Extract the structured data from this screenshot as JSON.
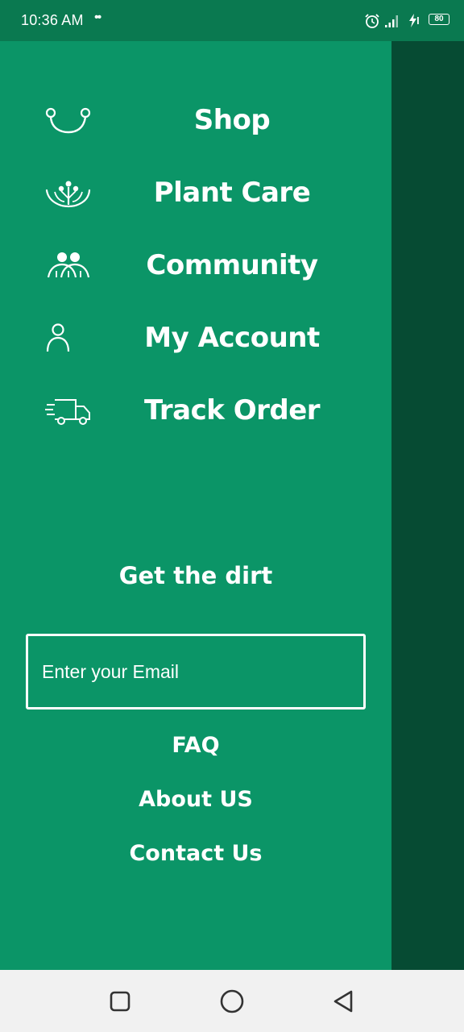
{
  "status_bar": {
    "time": "10:36 AM",
    "dots": "••",
    "battery": "80",
    "icons": [
      "alarm-icon",
      "signal-icon",
      "charging-icon",
      "battery-icon"
    ]
  },
  "drawer": {
    "menu": [
      {
        "label": "Shop",
        "icon": "shop-icon"
      },
      {
        "label": "Plant Care",
        "icon": "plant-care-icon"
      },
      {
        "label": "Community",
        "icon": "community-icon"
      },
      {
        "label": "My Account",
        "icon": "account-icon"
      },
      {
        "label": "Track Order",
        "icon": "truck-icon"
      }
    ],
    "newsletter_title": "Get the dirt",
    "email_placeholder": "Enter your Email",
    "links": {
      "faq": "FAQ",
      "about": "About US",
      "contact": "Contact Us"
    }
  },
  "colors": {
    "drawer_bg": "#0b9567",
    "status_bar_bg": "#0a7950",
    "overlay_bg": "#064b33",
    "text": "#ffffff",
    "nav_bar_bg": "#f1f1f1"
  },
  "nav_bar": {
    "buttons": [
      "recents-button",
      "home-button",
      "back-button"
    ]
  }
}
